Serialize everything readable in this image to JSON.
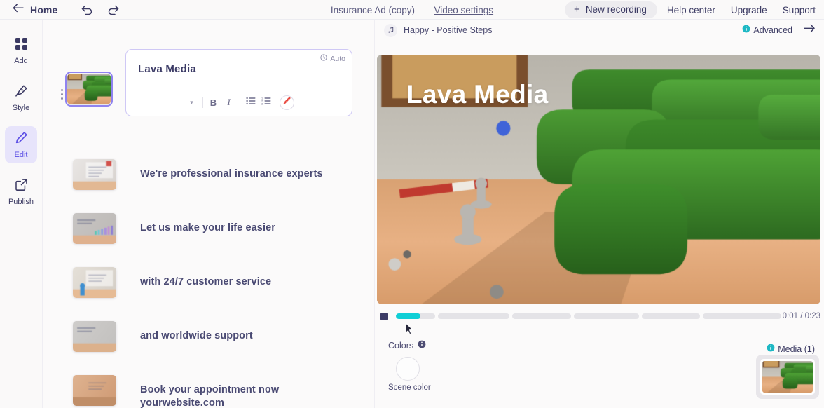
{
  "topbar": {
    "home_label": "Home",
    "back_icon": "arrow-left-icon",
    "undo_icon": "undo-icon",
    "redo_icon": "redo-icon",
    "doc_title": "Insurance Ad (copy)",
    "separator": "—",
    "video_settings_label": "Video settings",
    "new_recording_label": "New recording",
    "new_recording_plus": "+",
    "links": [
      "Help center",
      "Upgrade",
      "Support"
    ]
  },
  "rail": {
    "items": [
      {
        "label": "Add",
        "icon": "grid-icon",
        "active": false
      },
      {
        "label": "Style",
        "icon": "brush-icon",
        "active": false
      },
      {
        "label": "Edit",
        "icon": "pencil-icon",
        "active": true
      },
      {
        "label": "Publish",
        "icon": "share-export-icon",
        "active": false
      }
    ]
  },
  "edit_card": {
    "auto_label": "Auto",
    "auto_icon": "clock-icon",
    "title": "Lava Media",
    "format_buttons": [
      {
        "name": "font-size-chevron",
        "glyph": "▾"
      },
      {
        "name": "bold-button",
        "glyph": "B"
      },
      {
        "name": "italic-button",
        "glyph": "I"
      },
      {
        "name": "bullet-list-button",
        "glyph": "bullet-list-icon"
      },
      {
        "name": "numbered-list-button",
        "glyph": "numbered-list-icon"
      },
      {
        "name": "highlight-pen-button",
        "glyph": "pen-icon"
      }
    ]
  },
  "scenes": [
    {
      "text": "",
      "selected": true,
      "thumb": "scene-1-maze"
    },
    {
      "text": "We're professional insurance experts",
      "selected": false,
      "thumb": "scene-2-desk"
    },
    {
      "text": "Let us make your life easier",
      "selected": false,
      "thumb": "scene-3-chart"
    },
    {
      "text": "with 24/7 customer service",
      "selected": false,
      "thumb": "scene-4-service"
    },
    {
      "text": "and worldwide  support",
      "selected": false,
      "thumb": "scene-5-world"
    },
    {
      "text": "Book your appointment now\nyourwebsite.com",
      "selected": false,
      "thumb": "scene-6-book"
    }
  ],
  "preview": {
    "music_icon": "music-note-icon",
    "music_track": "Happy - Positive Steps",
    "advanced_label": "Advanced",
    "advanced_icon": "info-icon",
    "next_icon": "arrow-right-icon",
    "overlay_title": "Lava Media",
    "time_display": "0:01 / 0:23",
    "stop_button": "stop-square-icon",
    "progress_percent": 4,
    "segments": [
      6,
      11,
      9,
      10,
      9,
      12
    ],
    "filled_segment_index": 0,
    "filled_segment_fraction": 0.62
  },
  "colors": {
    "section_label": "Colors",
    "info_icon": "info-icon",
    "swatch_label": "Scene color",
    "swatch_hex": "#fdfdfd"
  },
  "media": {
    "label": "Media (1)",
    "info_icon": "info-icon",
    "thumb": "media-1-maze"
  },
  "theme": {
    "accent_purple": "#5b4ee5",
    "accent_purple_soft": "#e7e4fb",
    "teal": "#10cfd6",
    "info_teal": "#1eb8c4",
    "text_dark": "#3b3a63",
    "text_muted": "#6c6b8c",
    "bg": "#fbfafa"
  }
}
